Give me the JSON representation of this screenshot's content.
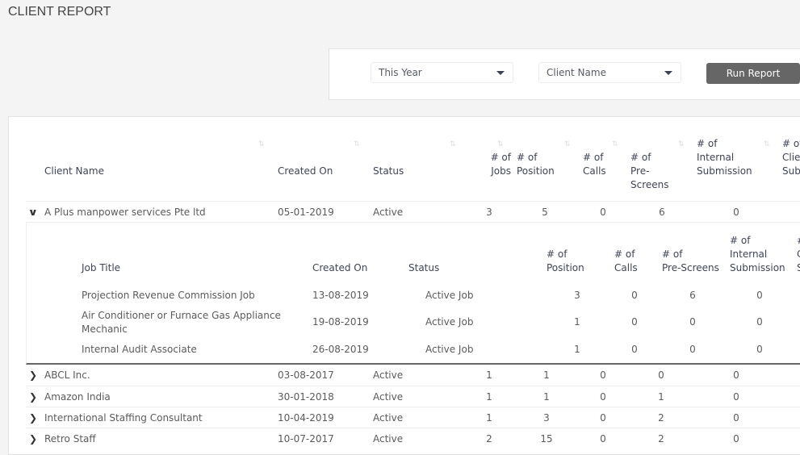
{
  "page": {
    "title": "CLIENT REPORT"
  },
  "filters": {
    "period_select": {
      "value": "This Year"
    },
    "client_select": {
      "value": "Client Name"
    },
    "run_button_label": "Run Report"
  },
  "main_table": {
    "columns": [
      {
        "label": "Client Name"
      },
      {
        "label": "Created On"
      },
      {
        "label": "Status"
      },
      {
        "label_lines": [
          "# of",
          "Jobs"
        ]
      },
      {
        "label_lines": [
          "# of",
          "Position"
        ]
      },
      {
        "label_lines": [
          "# of",
          "Calls"
        ]
      },
      {
        "label_lines": [
          "# of",
          "Pre-",
          "Screens"
        ]
      },
      {
        "label_lines": [
          "# of",
          "Internal",
          "Submission"
        ]
      },
      {
        "label_lines": [
          "# of",
          "Clie",
          "Sub"
        ]
      }
    ],
    "rows": [
      {
        "expanded": true,
        "client": "A Plus manpower services Pte ltd",
        "created_on": "05-01-2019",
        "status": "Active",
        "jobs": "3",
        "position": "5",
        "calls": "0",
        "pre_screens": "6",
        "internal_submission": "0"
      },
      {
        "expanded": false,
        "client": "ABCL Inc.",
        "created_on": "03-08-2017",
        "status": "Active",
        "jobs": "1",
        "position": "1",
        "calls": "0",
        "pre_screens": "0",
        "internal_submission": "0"
      },
      {
        "expanded": false,
        "client": "Amazon India",
        "created_on": "30-01-2018",
        "status": "Active",
        "jobs": "1",
        "position": "1",
        "calls": "0",
        "pre_screens": "1",
        "internal_submission": "0"
      },
      {
        "expanded": false,
        "client": "International Staffing Consultant",
        "created_on": "10-04-2019",
        "status": "Active",
        "jobs": "1",
        "position": "3",
        "calls": "0",
        "pre_screens": "2",
        "internal_submission": "0"
      },
      {
        "expanded": false,
        "client": "Retro Staff",
        "created_on": "10-07-2017",
        "status": "Active",
        "jobs": "2",
        "position": "15",
        "calls": "0",
        "pre_screens": "2",
        "internal_submission": "0"
      }
    ]
  },
  "sub_table": {
    "columns": [
      {
        "label": "Job Title"
      },
      {
        "label": "Created On"
      },
      {
        "label": "Status"
      },
      {
        "label_lines": [
          "# of",
          "Position"
        ]
      },
      {
        "label_lines": [
          "# of",
          "Calls"
        ]
      },
      {
        "label_lines": [
          "# of",
          "Pre-Screens"
        ]
      },
      {
        "label_lines": [
          "# of",
          "Internal",
          "Submission"
        ]
      },
      {
        "label_lines": [
          "#",
          "C",
          "S"
        ]
      }
    ],
    "rows": [
      {
        "title_lines": [
          "Projection Revenue Commission Job"
        ],
        "created_on": "13-08-2019",
        "status": "Active Job",
        "position": "3",
        "calls": "0",
        "pre_screens": "6",
        "internal_submission": "0"
      },
      {
        "title_lines": [
          "Air Conditioner or Furnace Gas Appliance",
          "Mechanic"
        ],
        "created_on": "19-08-2019",
        "status": "Active Job",
        "position": "1",
        "calls": "0",
        "pre_screens": "0",
        "internal_submission": "0"
      },
      {
        "title_lines": [
          "Internal Audit Associate"
        ],
        "created_on": "26-08-2019",
        "status": "Active Job",
        "position": "1",
        "calls": "0",
        "pre_screens": "0",
        "internal_submission": "0"
      }
    ]
  },
  "icons": {
    "sort": "⇅",
    "chevron_down": "⌄",
    "chevron_right": "›"
  }
}
